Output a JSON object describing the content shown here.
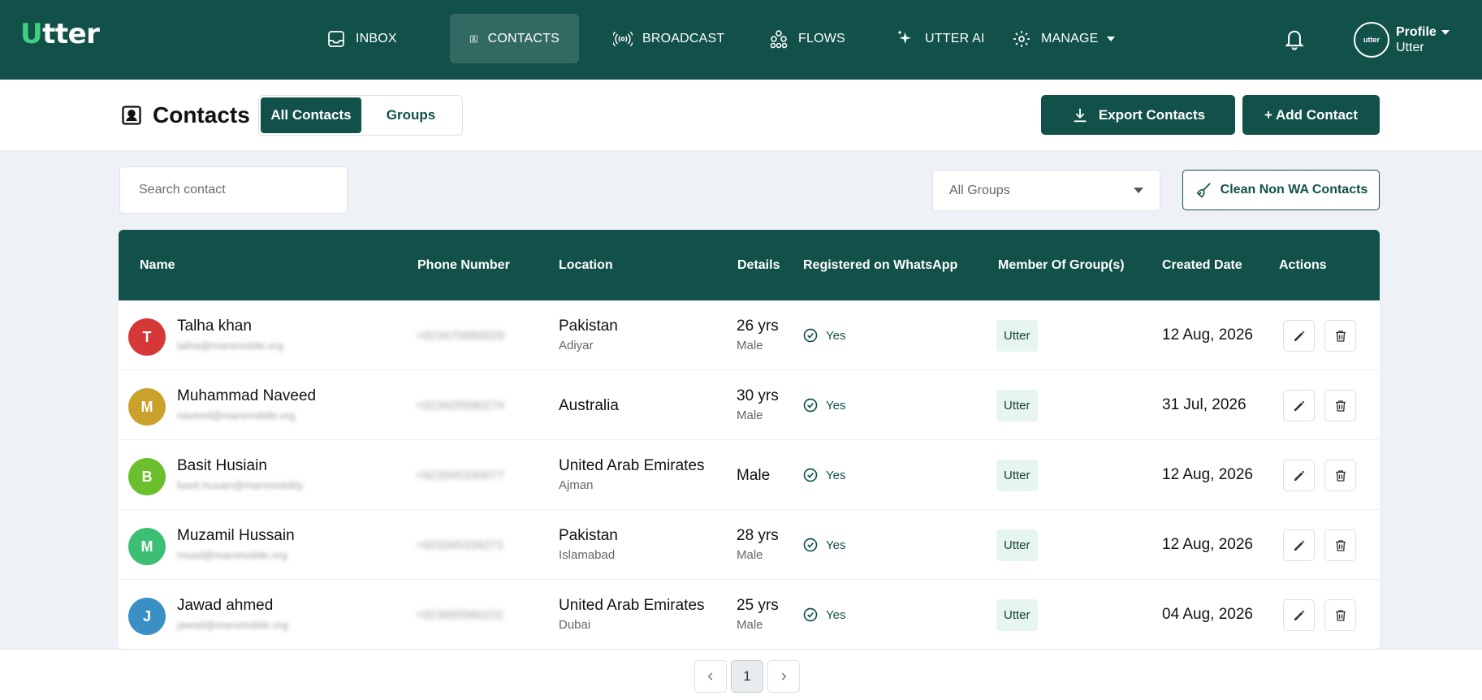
{
  "app": {
    "logo_first": "U",
    "logo_rest": "tter"
  },
  "nav": {
    "items": [
      {
        "label": "INBOX",
        "icon": "inbox-icon"
      },
      {
        "label": "CONTACTS",
        "icon": "contacts-icon",
        "active": true
      },
      {
        "label": "BROADCAST",
        "icon": "broadcast-icon"
      },
      {
        "label": "FLOWS",
        "icon": "flows-icon"
      },
      {
        "label": "UTTER AI",
        "icon": "sparkle-icon"
      },
      {
        "label": "MANAGE",
        "icon": "gear-icon"
      }
    ]
  },
  "profile": {
    "avatar_text": "utter",
    "name": "Profile",
    "org": "Utter"
  },
  "header": {
    "title": "Contacts",
    "tabs": [
      {
        "label": "All Contacts",
        "active": true
      },
      {
        "label": "Groups"
      }
    ],
    "export_label": "Export Contacts",
    "add_label": "+ Add Contact"
  },
  "filters": {
    "search_placeholder": "Search contact",
    "group_select": "All Groups",
    "clean_label": "Clean Non WA Contacts"
  },
  "table": {
    "columns": [
      "Name",
      "Phone Number",
      "Location",
      "Details",
      "Registered on WhatsApp",
      "Member Of Group(s)",
      "Created Date",
      "Actions"
    ],
    "rows": [
      {
        "initial": "T",
        "avatar_color": "#d63838",
        "name": "Talha khan",
        "email": "talha@marsmobile.org",
        "phone": "+923470660029",
        "location": "Pakistan",
        "sublocation": "Adiyar",
        "details": "26 yrs",
        "gender": "Male",
        "registered": "Yes",
        "group": "Utter",
        "created": "12 Aug, 2026"
      },
      {
        "initial": "M",
        "avatar_color": "#c9a12b",
        "name": "Muhammad Naveed",
        "email": "naveed@marsmobile.org",
        "phone": "+923425590274",
        "location": "Australia",
        "sublocation": "",
        "details": "30 yrs",
        "gender": "Male",
        "registered": "Yes",
        "group": "Utter",
        "created": "31 Jul, 2026"
      },
      {
        "initial": "B",
        "avatar_color": "#6bbf2d",
        "name": "Basit Husiain",
        "email": "basit.husain@marsmobility",
        "phone": "+923345330077",
        "location": "United Arab Emirates",
        "sublocation": "Ajman",
        "details": "Male",
        "gender": "",
        "registered": "Yes",
        "group": "Utter",
        "created": "12 Aug, 2026"
      },
      {
        "initial": "M",
        "avatar_color": "#3cbf73",
        "name": "Muzamil Hussain",
        "email": "muad@marsmobile.org",
        "phone": "+923345336271",
        "location": "Pakistan",
        "sublocation": "Islamabad",
        "details": "28 yrs",
        "gender": "Male",
        "registered": "Yes",
        "group": "Utter",
        "created": "12 Aug, 2026"
      },
      {
        "initial": "J",
        "avatar_color": "#3a8fc4",
        "name": "Jawad ahmed",
        "email": "jawad@marsmobile.org",
        "phone": "+923005560231",
        "location": "United Arab Emirates",
        "sublocation": "Dubai",
        "details": "25 yrs",
        "gender": "Male",
        "registered": "Yes",
        "group": "Utter",
        "created": "04 Aug, 2026"
      }
    ]
  },
  "pagination": {
    "current": "1"
  }
}
